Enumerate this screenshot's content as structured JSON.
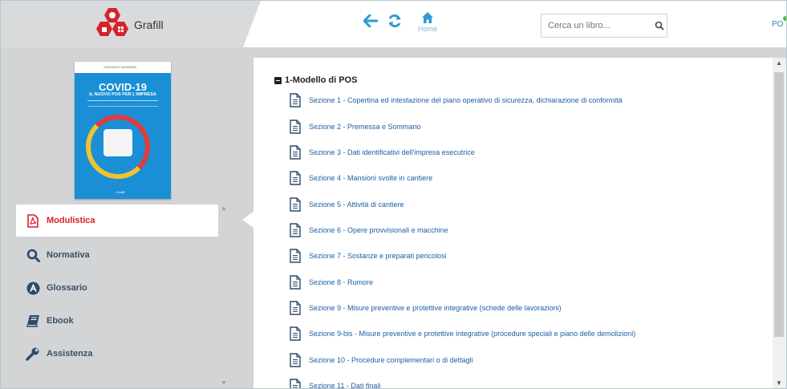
{
  "header": {
    "logo_text": "Grafill",
    "home_label": "Home",
    "search_placeholder": "Cerca un libro...",
    "user_initials": "PO"
  },
  "book_cover": {
    "author": "VINCENZO MAINARDI",
    "title": "COVID-19",
    "subtitle": "IL NUOVO POS PER L'IMPRESA",
    "publisher": "Grafill"
  },
  "sidebar": {
    "items": [
      {
        "label": "Modulistica",
        "icon": "document-pdf-icon",
        "active": true
      },
      {
        "label": "Normativa",
        "icon": "search-icon",
        "active": false
      },
      {
        "label": "Glossario",
        "icon": "glossary-icon",
        "active": false
      },
      {
        "label": "Ebook",
        "icon": "book-icon",
        "active": false
      },
      {
        "label": "Assistenza",
        "icon": "wrench-icon",
        "active": false
      }
    ]
  },
  "content": {
    "section_title": "1-Modello di POS",
    "items": [
      "Sezione 1 - Copertina ed intestazione del piano operativo di sicurezza, dichiarazione di conformità",
      "Sezione 2 - Premessa e Sommario",
      "Sezione 3 - Dati identificativi dell'impresa esecutrice",
      "Sezione 4 - Mansioni svolte in cantiere",
      "Sezione 5 - Attività di cantiere",
      "Sezione 6 - Opere provvisionali e macchine",
      "Sezione 7 - Sostanze e preparati pericolosi",
      "Sezione 8 - Rumore",
      "Sezione 9 - Misure preventive e protettive integrative (schede delle lavorazioni)",
      "Sezione 9-bis - Misure preventive e protettive integrative (procedure speciali e piano delle demolizioni)",
      "Sezione 10 - Procedure complementari o di dettagli",
      "Sezione 11 - Dati finali"
    ]
  },
  "colors": {
    "accent_blue": "#2e9bd6",
    "brand_red": "#d5232c",
    "link_blue": "#1d5fa3",
    "sidebar_bg": "#d2d4d6"
  }
}
